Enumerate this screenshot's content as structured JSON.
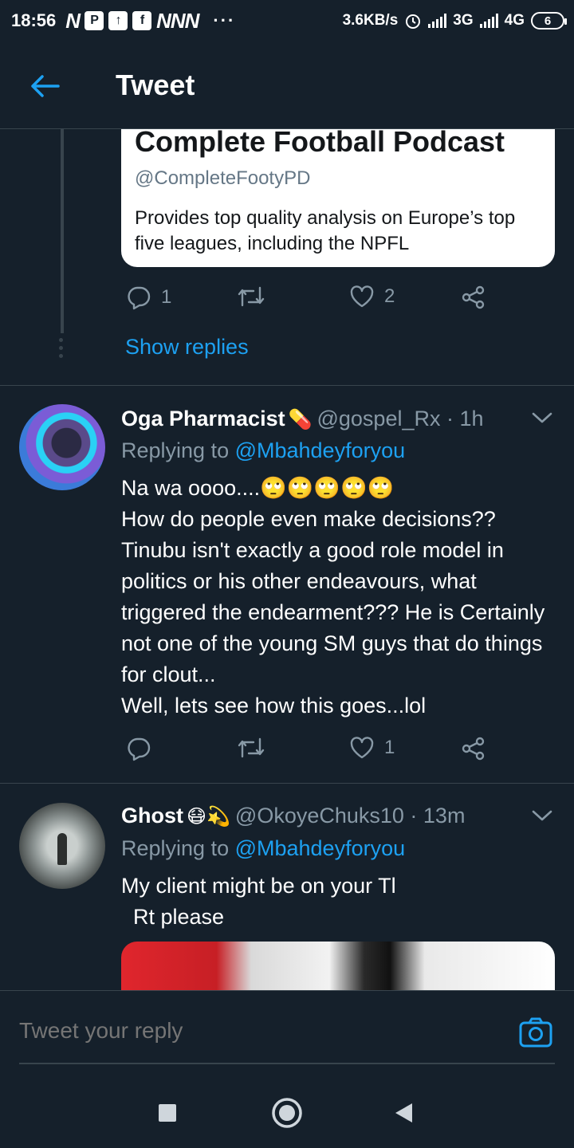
{
  "status_bar": {
    "time": "18:56",
    "notifications": "NNN",
    "net_speed": "3.6KB/s",
    "network_1": "3G",
    "network_2": "4G",
    "battery": "6"
  },
  "header": {
    "title": "Tweet",
    "back_icon": "arrow-left-icon"
  },
  "card": {
    "title": "Complete Football Podcast",
    "handle": "@CompleteFootyPD",
    "description": "Provides top quality analysis on Europe’s top five leagues, including the NPFL"
  },
  "top_actions": {
    "reply_count": "1",
    "retweet_count": "",
    "like_count": "2"
  },
  "show_replies": "Show replies",
  "tweets": [
    {
      "name": "Oga Pharmacist",
      "name_emoji": "💊",
      "handle": "@gospel_Rx · 1h",
      "replying_prefix": "Replying to ",
      "replying_to": "@Mbahdeyforyou",
      "text": "Na wa oooo....🙄🙄🙄🙄🙄\nHow do people even make decisions??\nTinubu isn't  exactly a good role model in politics or his other endeavours, what triggered the endearment??? He is Certainly not one of the young SM guys that do things for clout...\nWell, lets see how  this goes...lol",
      "reply_count": "",
      "retweet_count": "",
      "like_count": "1"
    },
    {
      "name": "Ghost",
      "name_emoji": "😷💫",
      "handle": "@OkoyeChuks10 · 13m",
      "replying_prefix": "Replying to ",
      "replying_to": "@Mbahdeyforyou",
      "text": "My client might be on your Tl\n  Rt please"
    }
  ],
  "reply_bar": {
    "placeholder": "Tweet your reply",
    "camera_icon": "camera-icon"
  },
  "colors": {
    "background": "#15202b",
    "accent": "#1da1f2",
    "muted": "#8899a6",
    "divider": "#38444d"
  }
}
